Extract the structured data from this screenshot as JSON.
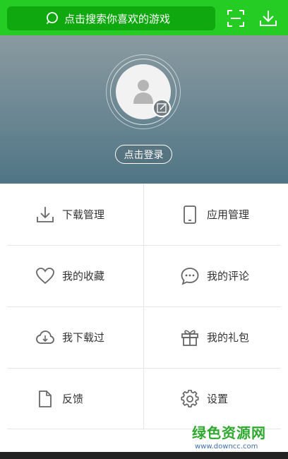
{
  "colors": {
    "topbar": "#24cc24",
    "search_bg": "#0fa80f",
    "header_top": "#8a9aa0",
    "header_bottom": "#4f7585",
    "icon": "#666666",
    "watermark_green": "#2fa82f"
  },
  "search": {
    "placeholder": "点击搜索你喜欢的游戏",
    "icon": "search-icon"
  },
  "toolbar": {
    "scan_icon": "scan-icon",
    "download_icon": "download-icon"
  },
  "profile": {
    "login_label": "点击登录",
    "avatar_icon": "user-avatar-icon",
    "edit_icon": "edit-icon"
  },
  "menu": [
    {
      "label": "下载管理",
      "icon": "download-manage-icon"
    },
    {
      "label": "应用管理",
      "icon": "phone-icon"
    },
    {
      "label": "我的收藏",
      "icon": "heart-icon"
    },
    {
      "label": "我的评论",
      "icon": "comment-icon"
    },
    {
      "label": "我下载过",
      "icon": "cloud-download-icon"
    },
    {
      "label": "我的礼包",
      "icon": "gift-icon"
    },
    {
      "label": "反馈",
      "icon": "document-icon"
    },
    {
      "label": "设置",
      "icon": "settings-gear-icon"
    }
  ],
  "watermark": {
    "title": "绿色资源网",
    "url": "www.downcc.com"
  }
}
